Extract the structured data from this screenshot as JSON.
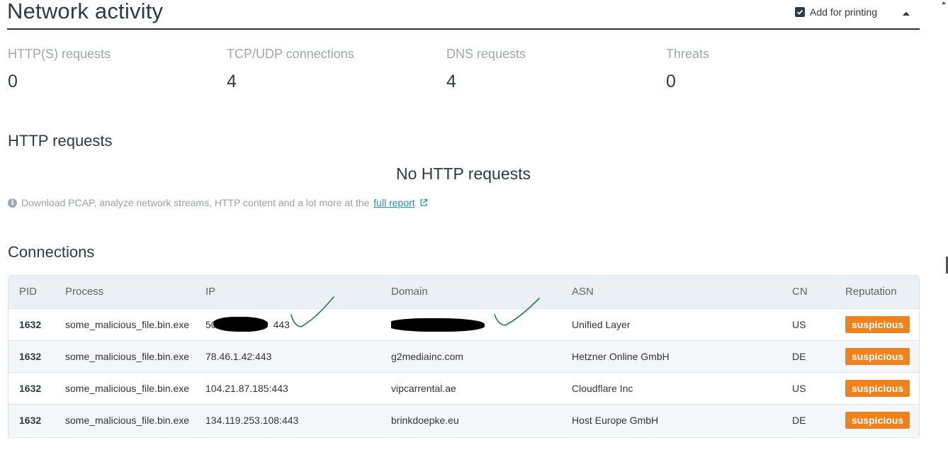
{
  "header": {
    "title": "Network activity",
    "print_label": "Add for printing",
    "print_checked": true
  },
  "stats": [
    {
      "label": "HTTP(S) requests",
      "value": "0"
    },
    {
      "label": "TCP/UDP connections",
      "value": "4"
    },
    {
      "label": "DNS requests",
      "value": "4"
    },
    {
      "label": "Threats",
      "value": "0"
    }
  ],
  "http_section": {
    "title": "HTTP requests",
    "empty_text": "No HTTP requests",
    "info_text": "Download PCAP, analyze network streams, HTTP content and a lot more at the",
    "link_text": "full report"
  },
  "connections": {
    "title": "Connections",
    "columns": [
      "PID",
      "Process",
      "IP",
      "Domain",
      "ASN",
      "CN",
      "Reputation"
    ],
    "rows": [
      {
        "pid": "1632",
        "process": "some_malicious_file.bin.exe",
        "ip_prefix": "50",
        "ip_suffix": "443",
        "ip": "",
        "domain": "",
        "asn": "Unified Layer",
        "cn": "US",
        "reputation": "suspicious",
        "redacted": true
      },
      {
        "pid": "1632",
        "process": "some_malicious_file.bin.exe",
        "ip": "78.46.1.42:443",
        "domain": "g2mediainc.com",
        "asn": "Hetzner Online GmbH",
        "cn": "DE",
        "reputation": "suspicious"
      },
      {
        "pid": "1632",
        "process": "some_malicious_file.bin.exe",
        "ip": "104.21.87.185:443",
        "domain": "vipcarrental.ae",
        "asn": "Cloudflare Inc",
        "cn": "US",
        "reputation": "suspicious"
      },
      {
        "pid": "1632",
        "process": "some_malicious_file.bin.exe",
        "ip": "134.119.253.108:443",
        "domain": "brinkdoepke.eu",
        "asn": "Host Europe GmbH",
        "cn": "DE",
        "reputation": "suspicious"
      }
    ]
  },
  "colors": {
    "badge": "#f0821e",
    "link": "#1a8fd8",
    "annotation_check": "#1f7a5a"
  }
}
